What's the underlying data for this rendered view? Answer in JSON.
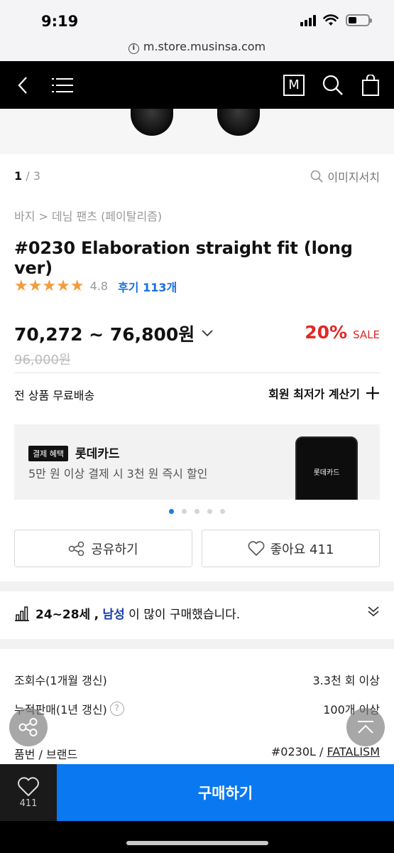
{
  "status_bar": {
    "time": "9:19"
  },
  "browser": {
    "url": "m.store.musinsa.com"
  },
  "nav": {
    "back_icon": "chevron-left-icon",
    "menu_icon": "hamburger-menu-icon",
    "logo_text": "M",
    "search_icon": "search-icon",
    "cart_icon": "shopping-bag-icon"
  },
  "gallery": {
    "current": "1",
    "total": "/ 3",
    "image_search_label": "이미지서치"
  },
  "product": {
    "breadcrumb": "바지 > 데님 팬츠 (페이탈리즘)",
    "title": "#0230 Elaboration straight fit (long ver)",
    "stars": "★★★★★",
    "rating": "4.8",
    "review_label": "후기 113개",
    "price_range": "70,272 ~ 76,800원",
    "discount_pct": "20%",
    "sale_label": "SALE",
    "original_price": "96,000원"
  },
  "shipping": {
    "label": "전 상품 무료배송",
    "calc_label": "회원 최저가 계산기"
  },
  "banner": {
    "tag": "결제 혜택",
    "card_name": "롯데카드",
    "description": "5만 원 이상 결제 시 3천 원 즉시 할인",
    "phone_brand": "롯데카드",
    "slides": 5,
    "active_slide": 1
  },
  "actions": {
    "share_label": "공유하기",
    "like_label": "좋아요 411"
  },
  "demographic": {
    "age": "24~28세",
    "separator": ",",
    "gender": "남성",
    "suffix": "이 많이 구매했습니다."
  },
  "info": {
    "rows": [
      {
        "label": "조회수(1개월 갱신)",
        "value": "3.3천 회 이상"
      },
      {
        "label": "누적판매(1년 갱신)",
        "value": "100개 이상"
      },
      {
        "label": "품번 / 브랜드",
        "value_code": "#0230L / ",
        "value_brand": "FATALISM"
      }
    ]
  },
  "bottom": {
    "like_count": "411",
    "buy_label": "구매하기"
  },
  "colors": {
    "accent": "#0a78f0",
    "sale": "#e02828",
    "star": "#f39b3d",
    "link": "#1a6fe0"
  }
}
